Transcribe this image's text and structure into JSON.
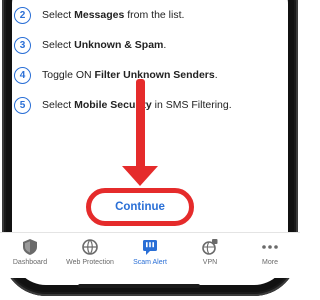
{
  "steps": [
    {
      "num": "2",
      "pre": "Select ",
      "bold": "Messages",
      "post": " from the list."
    },
    {
      "num": "3",
      "pre": "Select ",
      "bold": "Unknown & Spam",
      "post": "."
    },
    {
      "num": "4",
      "pre": "Toggle ON ",
      "bold": "Filter Unknown Senders",
      "post": "."
    },
    {
      "num": "5",
      "pre": "Select ",
      "bold": "Mobile Security",
      "post": " in SMS Filtering."
    }
  ],
  "continue_label": "Continue",
  "tabs": [
    {
      "label": "Dashboard",
      "icon": "shield-icon"
    },
    {
      "label": "Web Protection",
      "icon": "globe-shield-icon"
    },
    {
      "label": "Scam Alert",
      "icon": "scam-alert-icon",
      "active": true
    },
    {
      "label": "VPN",
      "icon": "vpn-icon"
    },
    {
      "label": "More",
      "icon": "more-icon"
    }
  ],
  "colors": {
    "accent": "#2a6fd6",
    "highlight": "#e52b2b",
    "inactive": "#6a6a6a"
  }
}
